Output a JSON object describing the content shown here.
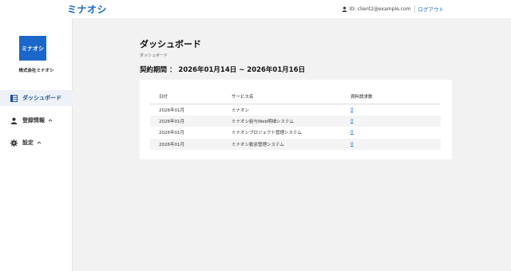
{
  "header": {
    "logo_text": "ミナオシ",
    "user_label": "ID: client2@example.com",
    "logout_label": "ログアウト"
  },
  "sidebar": {
    "company_logo_text": "ミナオシ",
    "company_name": "株式会社ミナオシ",
    "items": [
      {
        "label": "ダッシュボード",
        "icon": "dashboard-icon",
        "active": true
      },
      {
        "label": "登録情報",
        "icon": "person-icon",
        "expandable": true
      },
      {
        "label": "設定",
        "icon": "gear-icon",
        "expandable": true
      }
    ]
  },
  "main": {
    "title": "ダッシュボード",
    "breadcrumb": "ダッシュボード",
    "contract_period": "契約期間 ： 2026年01月14日 ~ 2026年01月16日"
  },
  "table": {
    "headers": [
      "日付",
      "サービス名",
      "資料請求数"
    ],
    "rows": [
      {
        "date": "2026年01月",
        "service": "ミナオシ",
        "count": "0"
      },
      {
        "date": "2026年01月",
        "service": "ミナオシ給与Web明細システム",
        "count": "0"
      },
      {
        "date": "2026年01月",
        "service": "ミナオシプロジェクト管理システム",
        "count": "0"
      },
      {
        "date": "2026年01月",
        "service": "ミナオシ勤怠管理システム",
        "count": "0"
      }
    ]
  },
  "colors": {
    "accent": "#1a67c9",
    "background": "#f2f2f2",
    "active_nav_bg": "#eef2f8"
  }
}
